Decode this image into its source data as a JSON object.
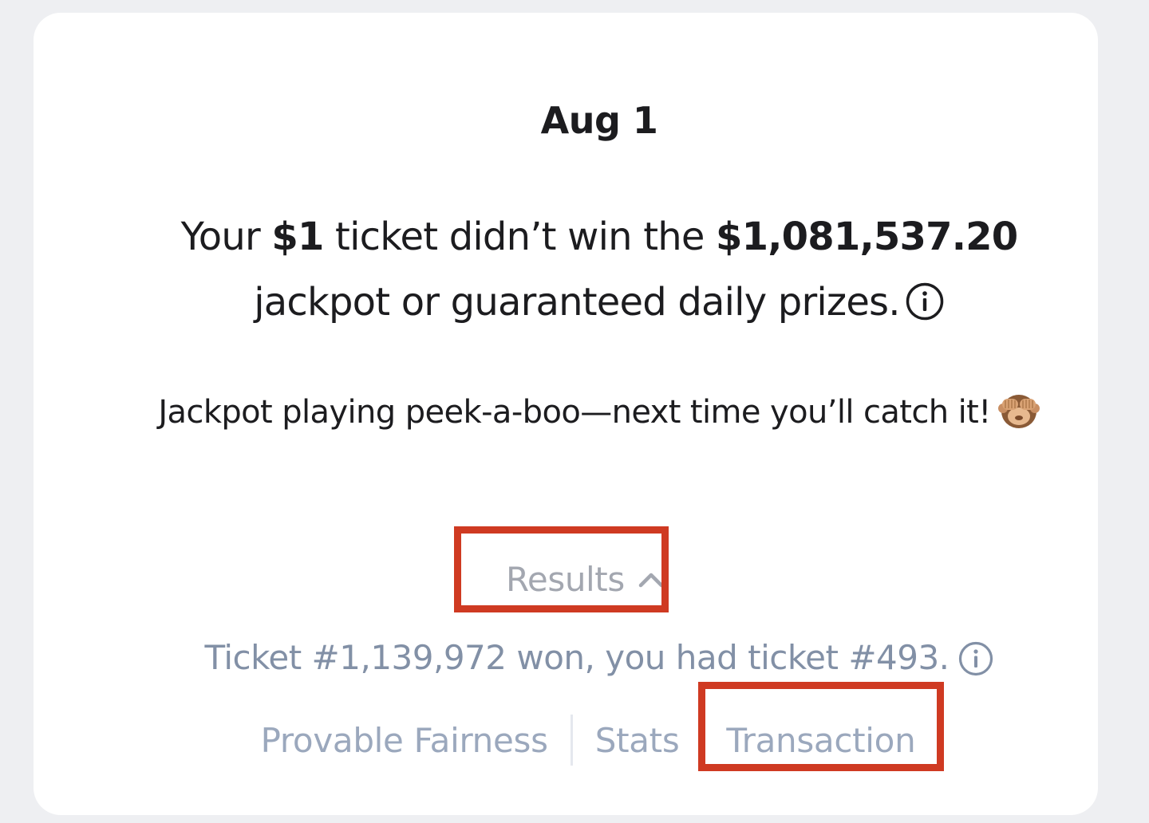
{
  "card": {
    "date": "Aug 1",
    "headline": {
      "part1": "Your ",
      "ticket_price": "$1",
      "part2": " ticket didn’t win the ",
      "jackpot_amount": "$1,081,537.20",
      "part3": " jackpot or guaranteed daily prizes."
    },
    "tagline": "Jackpot playing peek-a-boo—next time you’ll catch it!",
    "emoji_icon": "see-no-evil-monkey-icon",
    "results": {
      "label": "Results",
      "icon": "chevron-up-icon",
      "expanded": true
    },
    "ticket_info": "Ticket #1,139,972 won, you had ticket #493.",
    "links": {
      "provable_fairness": "Provable Fairness",
      "stats": "Stats",
      "transaction": "Transaction"
    }
  },
  "colors": {
    "highlight_border": "#cf3a22",
    "muted_text": "#a3a7b0",
    "link_text": "#9ba8bd",
    "ticket_text": "#8290a6",
    "primary_text": "#1c1c1f"
  }
}
